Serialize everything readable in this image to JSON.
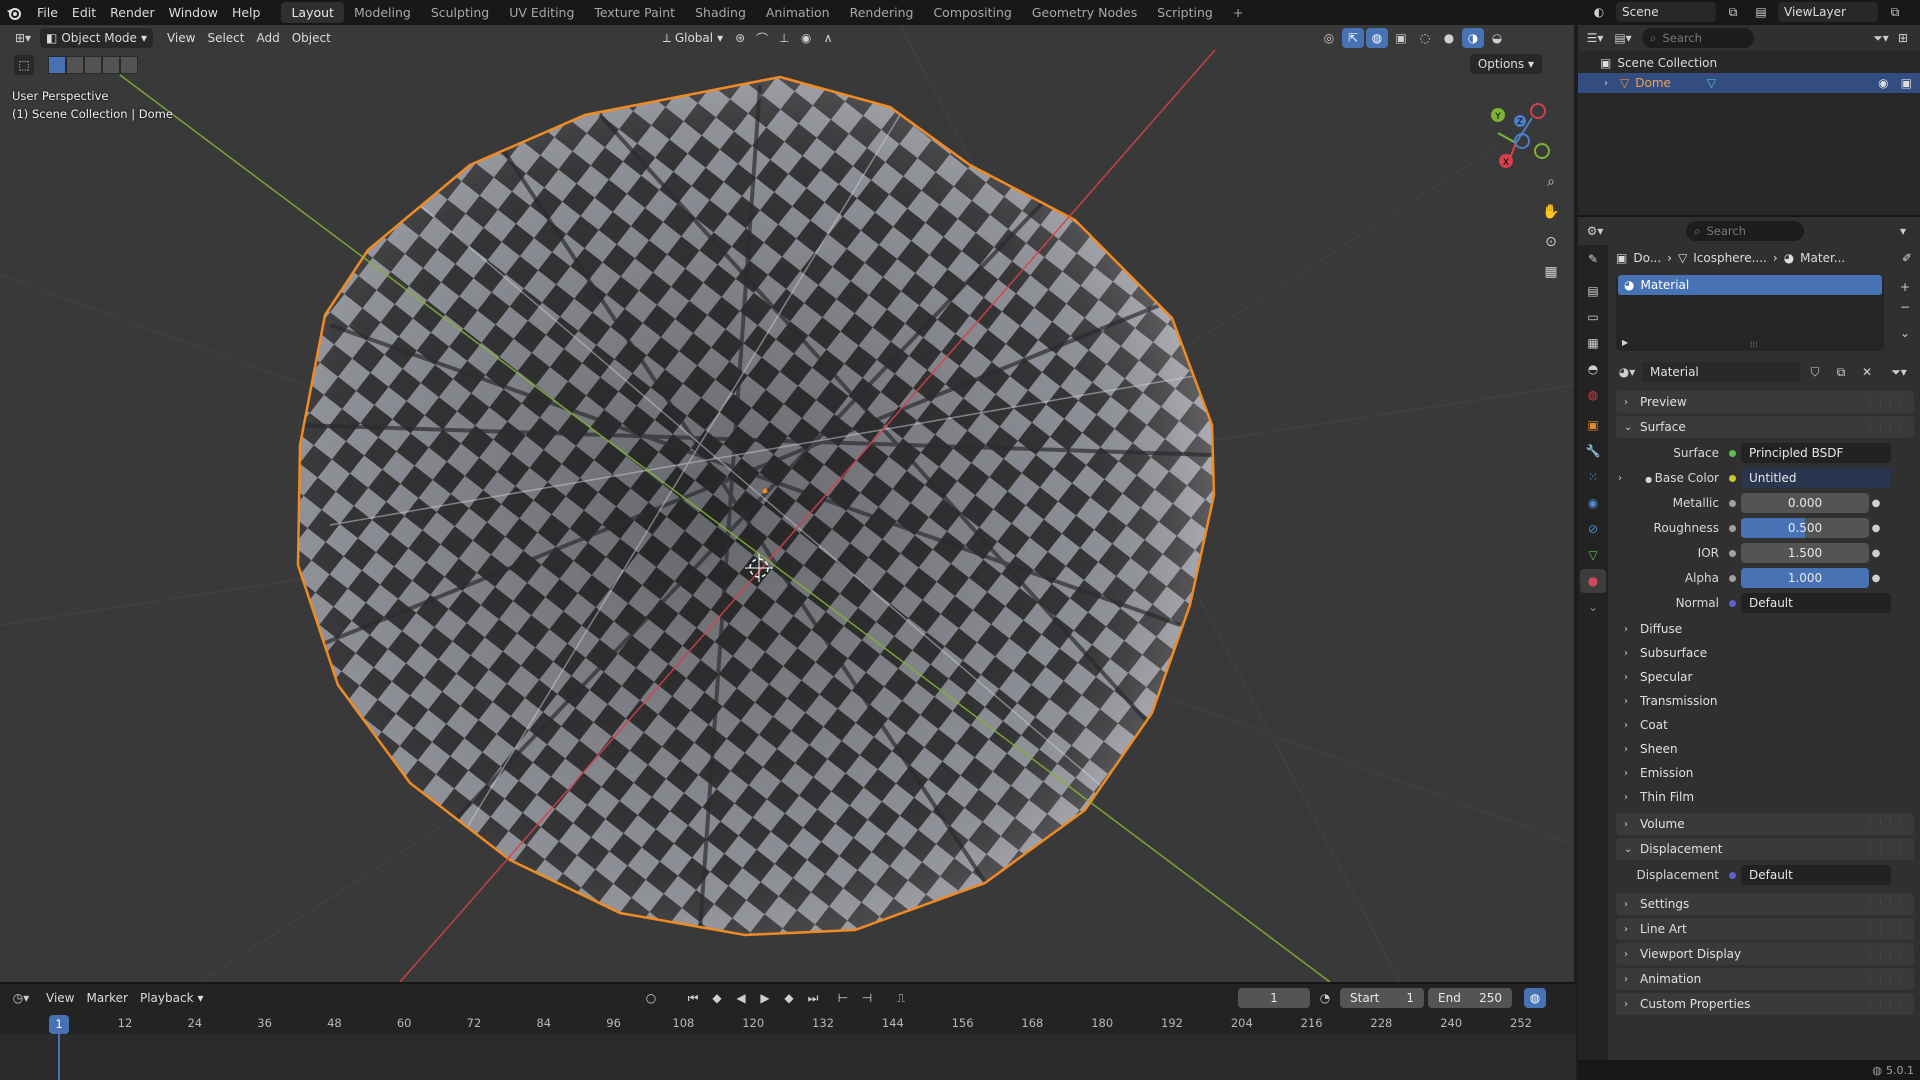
{
  "top_menu": [
    "File",
    "Edit",
    "Render",
    "Window",
    "Help"
  ],
  "workspaces": [
    {
      "label": "Layout",
      "active": true
    },
    {
      "label": "Modeling",
      "active": false
    },
    {
      "label": "Sculpting",
      "active": false
    },
    {
      "label": "UV Editing",
      "active": false
    },
    {
      "label": "Texture Paint",
      "active": false
    },
    {
      "label": "Shading",
      "active": false
    },
    {
      "label": "Animation",
      "active": false
    },
    {
      "label": "Rendering",
      "active": false
    },
    {
      "label": "Compositing",
      "active": false
    },
    {
      "label": "Geometry Nodes",
      "active": false
    },
    {
      "label": "Scripting",
      "active": false
    }
  ],
  "scene": {
    "label": "Scene",
    "view_layer": "ViewLayer"
  },
  "viewport": {
    "mode": "Object Mode",
    "menus": [
      "View",
      "Select",
      "Add",
      "Object"
    ],
    "transform_orientation": "Global",
    "options_label": "Options",
    "info_line1": "User Perspective",
    "info_line2": "(1) Scene Collection | Dome",
    "gizmo": {
      "x": "X",
      "y": "Y",
      "z": "Z"
    }
  },
  "outliner": {
    "search_placeholder": "Search",
    "root": "Scene Collection",
    "object": "Dome"
  },
  "properties": {
    "search_placeholder": "Search",
    "breadcrumb": [
      "Do...",
      "Icosphere....",
      "Mater..."
    ],
    "slot": "Material",
    "material_name": "Material",
    "panels": {
      "preview": "Preview",
      "surface": "Surface",
      "volume": "Volume",
      "displacement": "Displacement",
      "settings": "Settings",
      "line_art": "Line Art",
      "viewport_display": "Viewport Display",
      "animation": "Animation",
      "custom_properties": "Custom Properties"
    },
    "surface_rows": {
      "surface": {
        "label": "Surface",
        "value": "Principled BSDF"
      },
      "base_color": {
        "label": "Base Color",
        "value": "Untitled"
      },
      "metallic": {
        "label": "Metallic",
        "value": "0.000",
        "fraction": 0.0
      },
      "roughness": {
        "label": "Roughness",
        "value": "0.500",
        "fraction": 0.5
      },
      "ior": {
        "label": "IOR",
        "value": "1.500",
        "fraction": 0.0
      },
      "alpha": {
        "label": "Alpha",
        "value": "1.000",
        "fraction": 1.0
      },
      "normal": {
        "label": "Normal",
        "value": "Default"
      }
    },
    "subpanels": [
      "Diffuse",
      "Subsurface",
      "Specular",
      "Transmission",
      "Coat",
      "Sheen",
      "Emission",
      "Thin Film"
    ],
    "displacement_row": {
      "label": "Displacement",
      "value": "Default"
    }
  },
  "timeline": {
    "menus": [
      "View",
      "Marker",
      "Playback"
    ],
    "current_frame": "1",
    "start_label": "Start",
    "start": "1",
    "end_label": "End",
    "end": "250",
    "ticks": [
      "1",
      "12",
      "24",
      "36",
      "48",
      "60",
      "72",
      "84",
      "96",
      "108",
      "120",
      "132",
      "144",
      "156",
      "168",
      "180",
      "192",
      "204",
      "216",
      "228",
      "240",
      "252"
    ]
  },
  "status": {
    "version": "5.0.1"
  },
  "colors": {
    "accent": "#4772b3",
    "selection_outline": "#f08a24",
    "axis_x": "#d6404a",
    "axis_y": "#7fb236",
    "axis_z": "#4d7ec8"
  }
}
